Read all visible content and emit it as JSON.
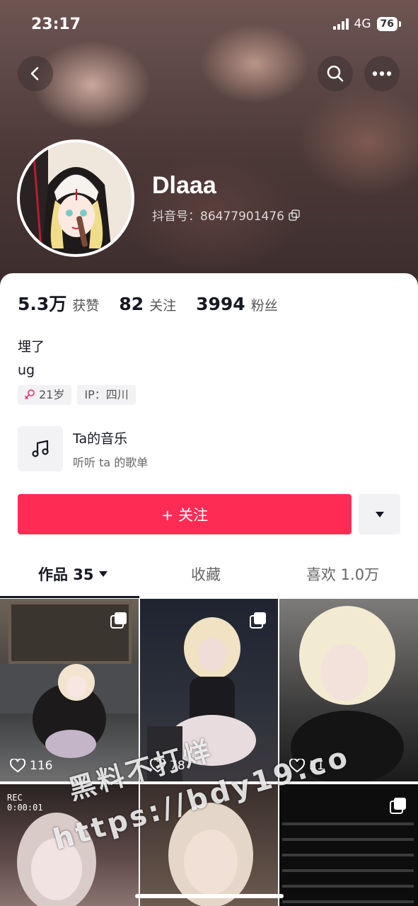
{
  "status_bar": {
    "time": "23:17",
    "network": "4G",
    "battery": "76"
  },
  "profile": {
    "nickname": "Dlaaa",
    "douyin_id": "抖音号：86477901476",
    "stats": [
      {
        "value": "5.3万",
        "label": "获赞"
      },
      {
        "value": "82",
        "label": "关注"
      },
      {
        "value": "3994",
        "label": "粉丝"
      }
    ],
    "bio_lines": [
      "埋了",
      "ug"
    ],
    "tags": {
      "age": "21岁",
      "ip": "IP：四川"
    },
    "gender_color": "#e8417a"
  },
  "music": {
    "title": "Ta的音乐",
    "subtitle": "听听 ta 的歌单"
  },
  "follow": {
    "label": "+ 关注",
    "accent": "#fe2c55"
  },
  "tabs": [
    {
      "label": "作品 35",
      "active": true
    },
    {
      "label": "收藏",
      "active": false
    },
    {
      "label": "喜欢 1.0万",
      "active": false
    }
  ],
  "grid": {
    "items": [
      {
        "likes": "116"
      },
      {
        "likes": "78"
      },
      {
        "likes": "51"
      }
    ],
    "rec_label": "REC",
    "rec_time": "0:00:01"
  },
  "watermark": {
    "line1": "黑料不打烊",
    "line2": "https://bdy19.co"
  }
}
